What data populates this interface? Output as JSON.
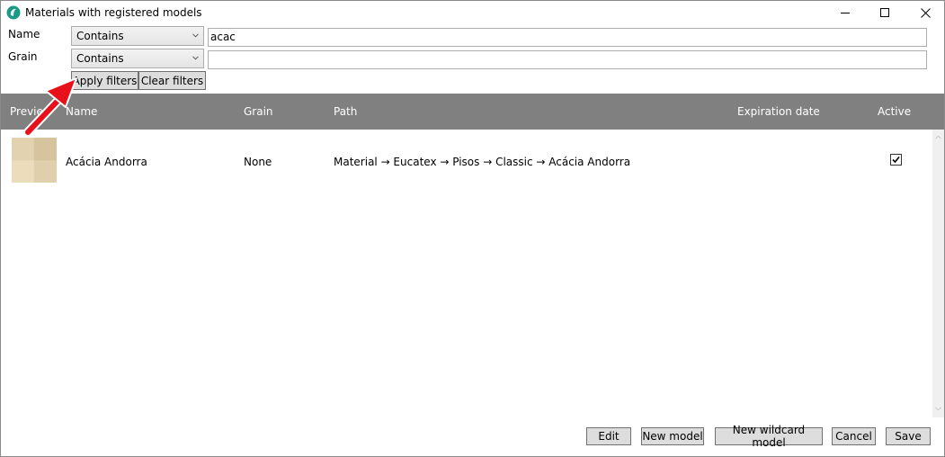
{
  "window": {
    "title": "Materials with registered models",
    "controls": {
      "minimize_icon": "minimize-icon",
      "maximize_icon": "maximize-icon",
      "close_icon": "close-icon"
    }
  },
  "filters": {
    "name": {
      "label": "Name",
      "mode": "Contains",
      "value": "acac"
    },
    "grain": {
      "label": "Grain",
      "mode": "Contains",
      "value": ""
    },
    "apply_label": "Apply filters",
    "clear_label": "Clear filters"
  },
  "grid": {
    "columns": [
      "Preview",
      "Name",
      "Grain",
      "Path",
      "Expiration date",
      "Active"
    ],
    "rows": [
      {
        "name": "Acácia Andorra",
        "grain": "None",
        "path": "Material → Eucatex → Pisos → Classic → Acácia Andorra",
        "expiration_date": "",
        "active": true
      }
    ]
  },
  "actions": {
    "edit": "Edit",
    "new_model": "New model",
    "new_wildcard_model": "New wildcard model",
    "cancel": "Cancel",
    "save": "Save"
  },
  "colors": {
    "header_bg": "#808080",
    "annotation_arrow": "#e8101a",
    "app_icon": "#1a9a86"
  }
}
